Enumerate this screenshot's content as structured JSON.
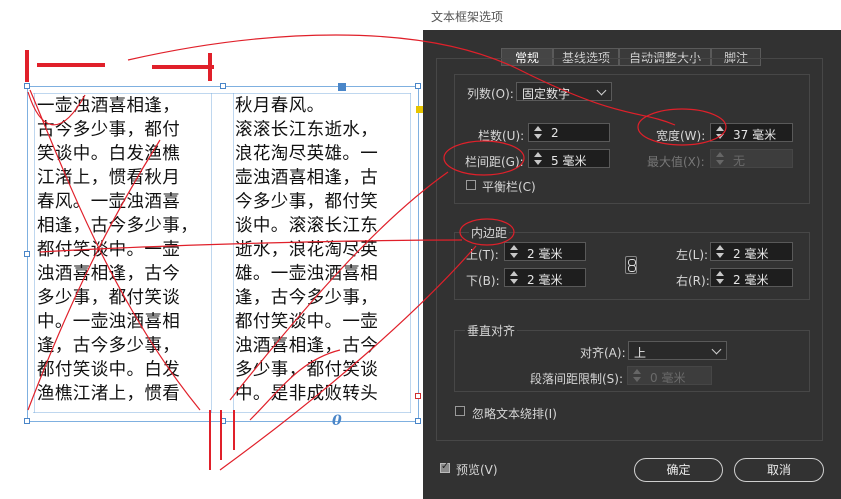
{
  "document": {
    "column1_lines": [
      "一壶浊酒喜相逢，",
      "古今多少事，都付",
      "笑谈中。白发渔樵",
      "江渚上，惯看秋月",
      "春风。一壶浊酒喜",
      "相逢，古今多少事，",
      "都付笑谈中。一壶",
      "浊酒喜相逢，古今",
      "多少事，都付笑谈",
      "中。一壶浊酒喜相",
      "逢，古今多少事，",
      "都付笑谈中。白发",
      "渔樵江渚上，惯看"
    ],
    "column2_lines": [
      "秋月春风。",
      "滚滚长江东逝水，",
      "浪花淘尽英雄。一",
      "壶浊酒喜相逢，古",
      "今多少事，都付笑",
      "谈中。滚滚长江东",
      "逝水，浪花淘尽英",
      "雄。一壶浊酒喜相",
      "逢，古今多少事，",
      "都付笑谈中。一壶",
      "浊酒喜相逢，古今",
      "多少事，都付笑谈",
      "中。是非成败转头"
    ],
    "overflow_marker": "0"
  },
  "dialog": {
    "title": "文本框架选项",
    "tabs": [
      "常规",
      "基线选项",
      "自动调整大小",
      "脚注"
    ],
    "active_tab": "常规",
    "columns": {
      "label": "列数(O):",
      "type_value": "固定数字",
      "count_label": "栏数(U):",
      "count_value": "2",
      "gutter_label": "栏间距(G):",
      "gutter_value": "5 毫米",
      "width_label": "宽度(W):",
      "width_value": "37 毫米",
      "max_label": "最大值(X):",
      "max_value": "无",
      "balance_label": "平衡栏(C)"
    },
    "inset": {
      "label": "内边距",
      "top_label": "上(T):",
      "top_value": "2 毫米",
      "bottom_label": "下(B):",
      "bottom_value": "2 毫米",
      "left_label": "左(L):",
      "left_value": "2 毫米",
      "right_label": "右(R):",
      "right_value": "2 毫米"
    },
    "vertical": {
      "label": "垂直对齐",
      "align_label": "对齐(A):",
      "align_value": "上",
      "spacing_label": "段落间距限制(S):",
      "spacing_value": "0 毫米"
    },
    "ignore_wrap_label": "忽略文本绕排(I)",
    "preview_label": "预览(V)",
    "ok_label": "确定",
    "cancel_label": "取消"
  },
  "colors": {
    "annotation_red": "#e0202a",
    "frame_blue": "#4a86c8",
    "dialog_bg": "#323232"
  }
}
